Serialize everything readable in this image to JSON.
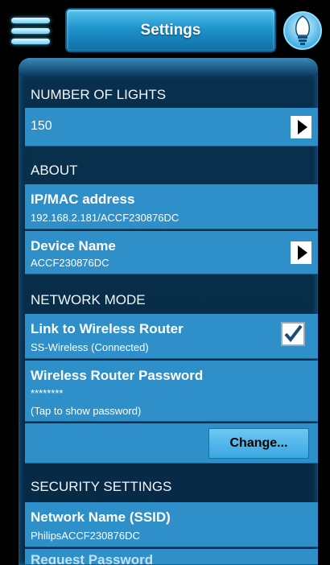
{
  "header": {
    "title": "Settings",
    "menu_icon": "hamburger-menu-icon",
    "bulb_icon": "light-bulb-icon"
  },
  "colors": {
    "accent": "#2e8fc9",
    "panel": "#08304d",
    "background": "#000000"
  },
  "sections": {
    "lights": {
      "heading": "NUMBER OF LIGHTS",
      "value": "150"
    },
    "about": {
      "heading": "ABOUT",
      "ip_label": "IP/MAC address",
      "ip_value": "192.168.2.181/ACCF230876DC",
      "device_label": "Device Name",
      "device_value": "ACCF230876DC"
    },
    "network": {
      "heading": "NETWORK MODE",
      "link_label": "Link to Wireless Router",
      "link_value": "SS-Wireless (Connected)",
      "link_checked": true,
      "pwd_label": "Wireless Router Password",
      "pwd_masked": "********",
      "pwd_hint": "(Tap to show password)",
      "change_label": "Change..."
    },
    "security": {
      "heading": "SECURITY SETTINGS",
      "ssid_label": "Network Name (SSID)",
      "ssid_value": "PhilipsACCF230876DC",
      "request_label": "Request Password"
    }
  }
}
